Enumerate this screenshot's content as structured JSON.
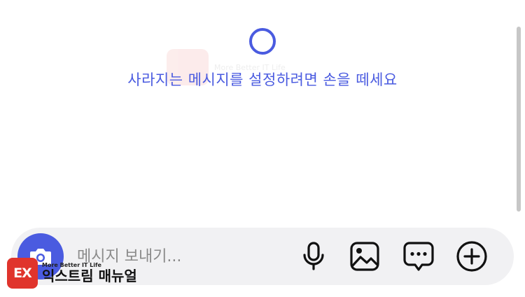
{
  "overlay": {
    "hint_text": "사라지는 메시지를 설정하려면 손을 떼세요"
  },
  "composer": {
    "placeholder": "메시지 보내기..."
  },
  "watermark": {
    "logo_text": "EX",
    "tagline": "More Better IT Life",
    "name": "익스트림 매뉴얼"
  },
  "colors": {
    "accent": "#4a5be0",
    "composer_bg": "#f1f1f3",
    "icon": "#111111",
    "watermark_red": "#e0342c"
  },
  "icons": [
    "camera-icon",
    "microphone-icon",
    "image-icon",
    "sticker-message-icon",
    "plus-circle-icon"
  ]
}
